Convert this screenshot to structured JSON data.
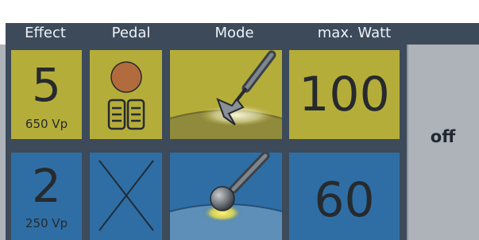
{
  "header": {
    "effect_label": "Effect",
    "pedal_label": "Pedal",
    "mode_label": "Mode",
    "max_watt_label": "max. Watt"
  },
  "rows": [
    {
      "color": "#b5ad3a",
      "effect_value": "5",
      "effect_sub": "650 Vp",
      "pedal_icon": "double-pedal-icon",
      "mode_icon": "spatula-electrode-icon",
      "max_watt": "100"
    },
    {
      "color": "#2f6ea4",
      "effect_value": "2",
      "effect_sub": "250 Vp",
      "pedal_icon": "no-pedal-cross-icon",
      "mode_icon": "ball-electrode-icon",
      "max_watt": "60"
    }
  ],
  "status": {
    "label": "off"
  }
}
